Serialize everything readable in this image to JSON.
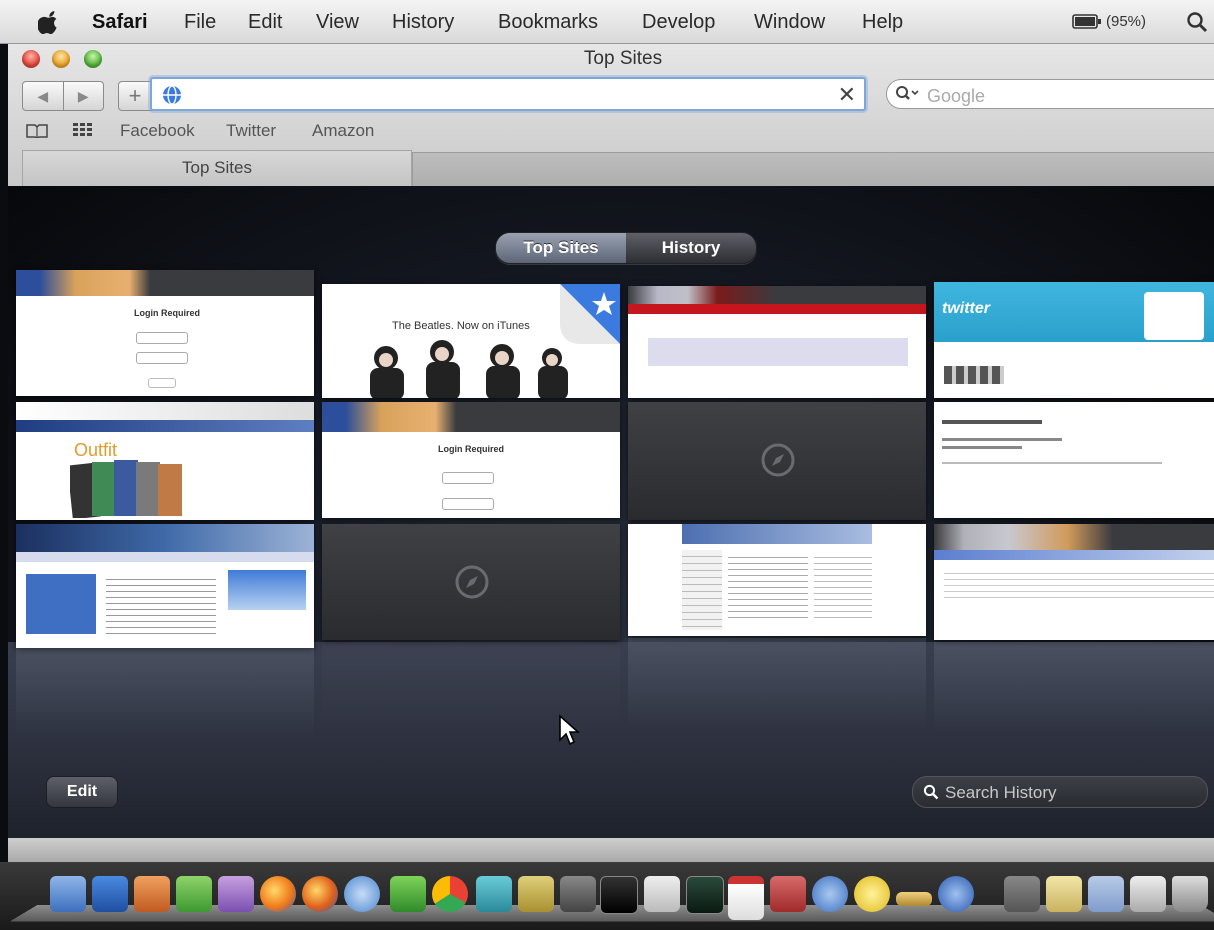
{
  "menubar": {
    "app": "Safari",
    "items": [
      "File",
      "Edit",
      "View",
      "History",
      "Bookmarks",
      "Develop",
      "Window",
      "Help"
    ],
    "battery": "(95%)"
  },
  "window": {
    "title": "Top Sites",
    "url_value": "",
    "search_placeholder": "Google",
    "bookmarks": [
      "Facebook",
      "Twitter",
      "Amazon"
    ],
    "tab_label": "Top Sites"
  },
  "topsites": {
    "seg_top": "Top Sites",
    "seg_history": "History",
    "edit_label": "Edit",
    "search_history_placeholder": "Search History",
    "tiles": {
      "login_title": "Login Required",
      "beatles_caption": "The Beatles. Now on iTunes"
    }
  },
  "colors": {
    "accent_blue": "#2d6fd6",
    "seg_active": "#7c8596",
    "dark_bg": "#141821"
  }
}
